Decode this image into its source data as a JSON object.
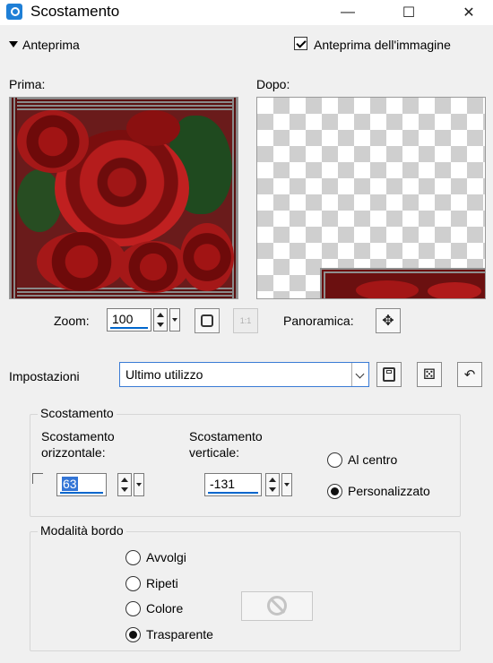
{
  "window": {
    "title": "Scostamento",
    "minimize": "—",
    "maximize": "☐",
    "close": "✕"
  },
  "preview": {
    "toggle_label": "Anteprima",
    "image_preview_label": "Anteprima dell'immagine",
    "image_preview_checked": true,
    "before_label": "Prima:",
    "after_label": "Dopo:"
  },
  "zoom": {
    "label": "Zoom:",
    "value": "100",
    "pan_label": "Panoramica:",
    "fit_icon": "fit-icon",
    "actual_size": "1:1"
  },
  "settings": {
    "label": "Impostazioni",
    "preset": "Ultimo utilizzo"
  },
  "offset": {
    "group_title": "Scostamento",
    "h_label_line1": "Scostamento",
    "h_label_line2": "orizzontale:",
    "h_value": "63",
    "v_label_line1": "Scostamento",
    "v_label_line2": "verticale:",
    "v_value": "-131",
    "center_label": "Al centro",
    "custom_label": "Personalizzato",
    "selected": "Personalizzato"
  },
  "edge_mode": {
    "group_title": "Modalità bordo",
    "options": [
      "Avvolgi",
      "Ripeti",
      "Colore",
      "Trasparente"
    ],
    "selected": "Trasparente"
  }
}
